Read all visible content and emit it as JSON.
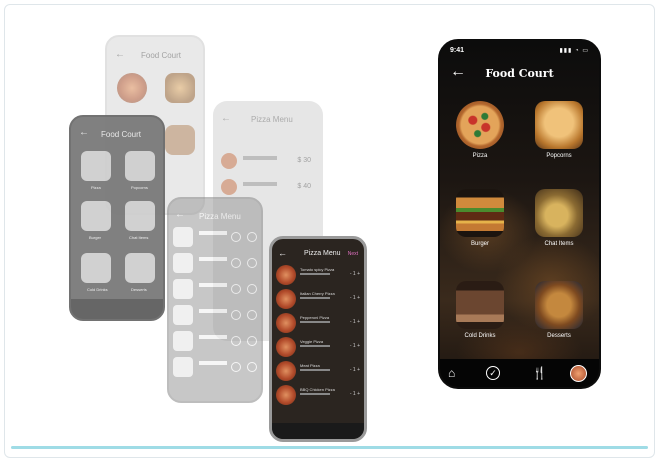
{
  "ghost": {
    "back_title": "Food Court",
    "menu_title": "Pizza Menu",
    "grey_title": "Food Court",
    "mid_title": "Pizza Menu",
    "front_title": "Pizza Menu",
    "front_next": "Next",
    "menu_prices": [
      "$ 30",
      "$ 40"
    ],
    "menu_rows": [
      "Tomato spicy Pizza",
      "Pepperoni Pizza"
    ],
    "front_rows": [
      "Tomato spicy Pizza",
      "Italian Cherry Pizza",
      "Pepperoni Pizza",
      "Veggie Pizza",
      "Meat Pizza",
      "BBQ Chicken Pizza"
    ],
    "grey_labels": [
      "Pizza",
      "Popcorns",
      "Burger",
      "Chat Items",
      "Cold Drinks",
      "Desserts"
    ]
  },
  "phone": {
    "time": "9:41",
    "status_icons": "▮▮▮ ◔ ▭",
    "back_icon": "back-arrow-icon",
    "title": "Food Court",
    "items": [
      {
        "label": "Pizza"
      },
      {
        "label": "Popcorns"
      },
      {
        "label": "Burger"
      },
      {
        "label": "Chat Items"
      },
      {
        "label": "Cold Drinks"
      },
      {
        "label": "Desserts"
      }
    ],
    "nav": [
      "home-icon",
      "check-circle-icon",
      "fork-knife-icon",
      "profile-avatar"
    ]
  }
}
